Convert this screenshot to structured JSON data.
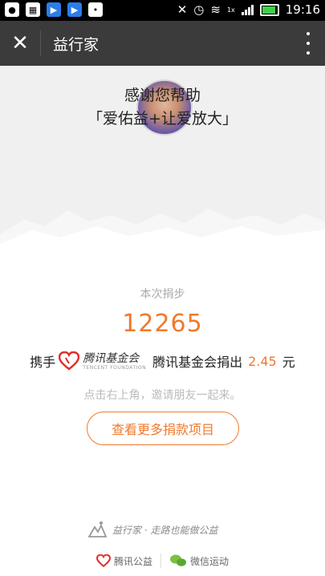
{
  "status_bar": {
    "time": "19:16",
    "network_label": "1x"
  },
  "title_bar": {
    "title": "益行家"
  },
  "hero": {
    "thanks_text": "感谢您帮助",
    "project_slogan": "「爱佑益+让爱放大」"
  },
  "donation": {
    "step_label": "本次捐步",
    "step_count": "12265",
    "prefix": "携手",
    "foundation_logo_cn": "腾讯基金会",
    "foundation_logo_en": "TENCENT FOUNDATION",
    "foundation_name": "腾讯基金会捐出",
    "amount": "2.45",
    "unit": "元",
    "invite_text": "点击右上角，邀请朋友一起来。",
    "more_button": "查看更多捐款项目"
  },
  "footer": {
    "slogan": "益行家 · 走路也能做公益",
    "brand_left": "腾讯公益",
    "brand_right": "微信运动"
  },
  "colors": {
    "accent": "#f07a2c",
    "titlebar": "#3b3b3b"
  }
}
